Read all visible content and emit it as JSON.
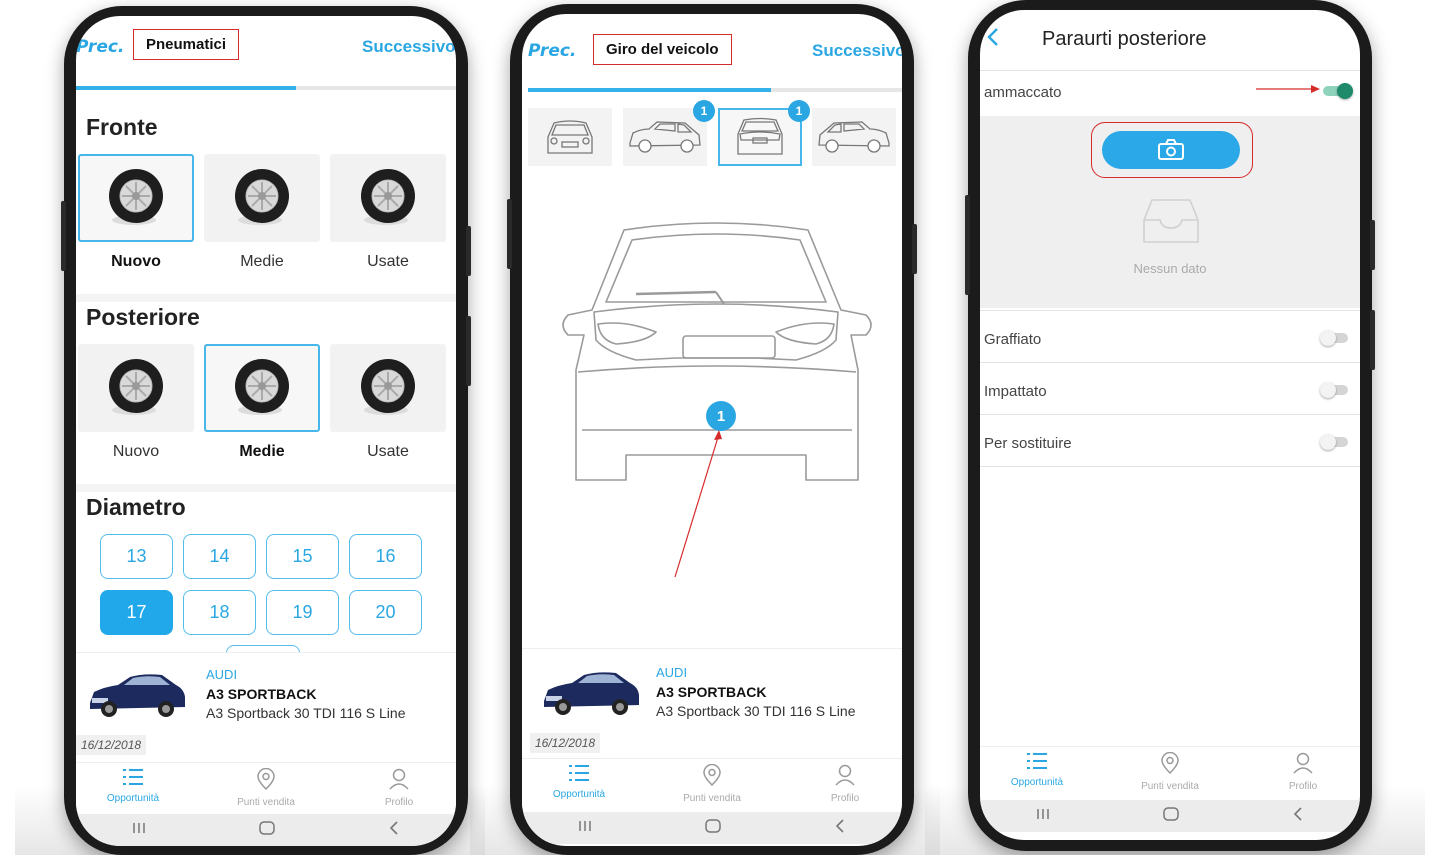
{
  "colors": {
    "accent": "#2aa7e3",
    "highlight_box": "#d62b2b",
    "toggle_on": "#1e8a6a"
  },
  "phone1": {
    "header": {
      "prev": "Prec.",
      "title": "Pneumatici",
      "next": "Successivo"
    },
    "progress": 0.58,
    "front": {
      "title": "Fronte",
      "options": [
        {
          "label": "Nuovo",
          "selected": true,
          "icon": "tire-icon"
        },
        {
          "label": "Medie",
          "selected": false,
          "icon": "tire-icon"
        },
        {
          "label": "Usate",
          "selected": false,
          "icon": "tire-icon"
        }
      ]
    },
    "rear": {
      "title": "Posteriore",
      "options": [
        {
          "label": "Nuovo",
          "selected": false,
          "icon": "tire-icon"
        },
        {
          "label": "Medie",
          "selected": true,
          "icon": "tire-icon"
        },
        {
          "label": "Usate",
          "selected": false,
          "icon": "tire-icon"
        }
      ]
    },
    "diameter": {
      "title": "Diametro",
      "values": [
        "13",
        "14",
        "15",
        "16",
        "17",
        "18",
        "19",
        "20"
      ],
      "selected": "17"
    },
    "vehicle": {
      "brand": "AUDI",
      "model": "A3 SPORTBACK",
      "desc": "A3 Sportback 30 TDI 116 S Line",
      "date": "16/12/2018"
    },
    "nav": {
      "items": [
        {
          "label": "Opportunità",
          "icon": "list-icon"
        },
        {
          "label": "Punti vendita",
          "icon": "location-pin-icon"
        },
        {
          "label": "Profilo",
          "icon": "user-icon"
        }
      ]
    }
  },
  "phone2": {
    "header": {
      "prev": "Prec.",
      "title": "Giro del veicolo",
      "next": "Successivo"
    },
    "progress": 0.65,
    "thumbs": [
      {
        "name": "front-view",
        "badge": ""
      },
      {
        "name": "side-left-view",
        "badge": "1"
      },
      {
        "name": "rear-view",
        "badge": "1",
        "selected": true
      },
      {
        "name": "side-right-view",
        "badge": ""
      }
    ],
    "damage_marker": "1",
    "vehicle": {
      "brand": "AUDI",
      "model": "A3 SPORTBACK",
      "desc": "A3 Sportback 30 TDI 116 S Line",
      "date": "16/12/2018"
    },
    "nav": {
      "items": [
        {
          "label": "Opportunità",
          "icon": "list-icon"
        },
        {
          "label": "Punti vendita",
          "icon": "location-pin-icon"
        },
        {
          "label": "Profilo",
          "icon": "user-icon"
        }
      ]
    }
  },
  "phone3": {
    "title": "Paraurti posteriore",
    "rows": [
      {
        "label": "ammaccato",
        "on": true
      },
      {
        "label": "Graffiato",
        "on": false
      },
      {
        "label": "Impattato",
        "on": false
      },
      {
        "label": "Per sostituire",
        "on": false
      }
    ],
    "empty_text": "Nessun dato",
    "nav": {
      "items": [
        {
          "label": "Opportunità",
          "icon": "list-icon"
        },
        {
          "label": "Punti vendita",
          "icon": "location-pin-icon"
        },
        {
          "label": "Profilo",
          "icon": "user-icon"
        }
      ]
    }
  }
}
